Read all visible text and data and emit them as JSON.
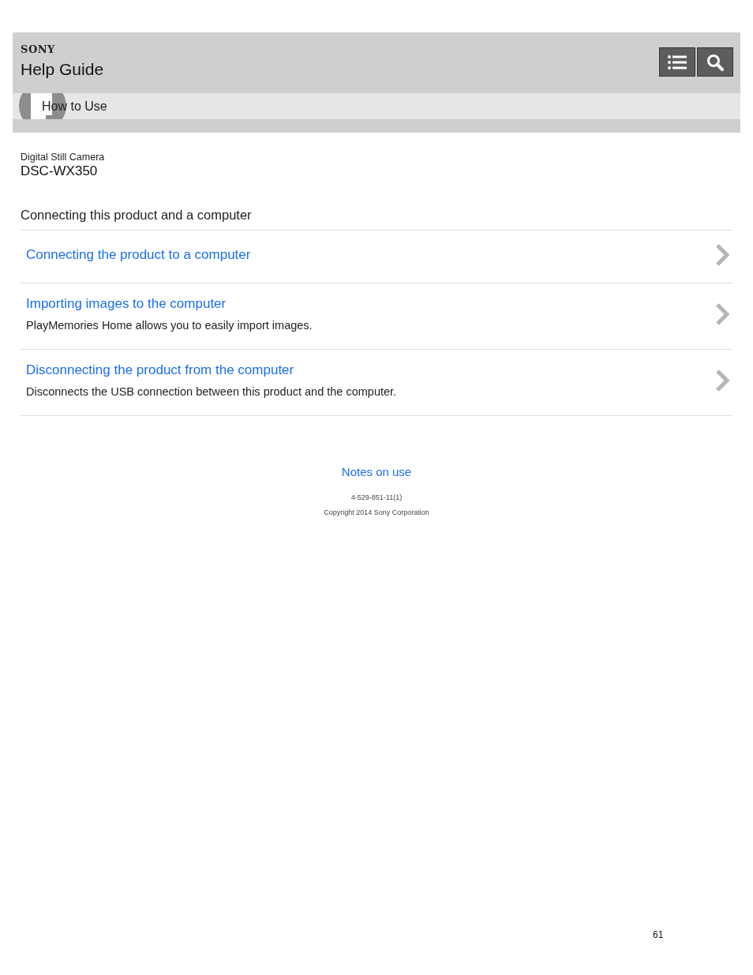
{
  "header": {
    "brand": "SONY",
    "title": "Help Guide",
    "buttons": [
      {
        "kind": "list"
      },
      {
        "kind": "search"
      }
    ]
  },
  "breadcrumb": {
    "label": "How to Use"
  },
  "product": {
    "category": "Digital Still Camera",
    "model": "DSC-WX350"
  },
  "section": {
    "title": "Connecting this product and a computer",
    "items": [
      {
        "title": "Connecting the product to a computer"
      },
      {
        "title": "Importing images to the computer",
        "description": "PlayMemories Home allows you to easily import images."
      },
      {
        "title": "Disconnecting the product from the computer",
        "description": "Disconnects the USB connection between this product and the computer."
      }
    ]
  },
  "footer": {
    "link": "Notes on use",
    "code": "4-529-851-11(1)",
    "copyright": "Copyright 2014 Sony Corporation"
  },
  "page_number": "61"
}
